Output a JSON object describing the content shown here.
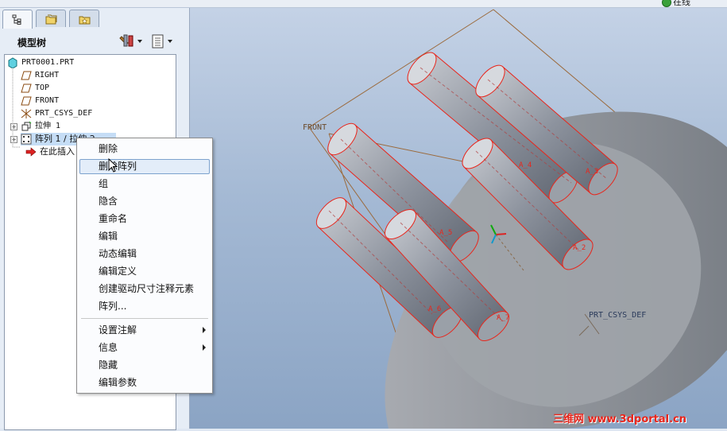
{
  "status": {
    "text": "在线"
  },
  "panel": {
    "tabs": [
      {
        "name": "model-tree",
        "icon": "tree-icon"
      },
      {
        "name": "folders",
        "icon": "folder-icon"
      },
      {
        "name": "favorites",
        "icon": "favorites-icon"
      }
    ],
    "title": "模型树",
    "settings_icon": "tools-icon",
    "show_icon": "list-icon"
  },
  "tree": {
    "items": [
      {
        "label": "PRT0001.PRT",
        "icon": "part-icon"
      },
      {
        "label": "RIGHT",
        "icon": "datum-plane-icon"
      },
      {
        "label": "TOP",
        "icon": "datum-plane-icon"
      },
      {
        "label": "FRONT",
        "icon": "datum-plane-icon"
      },
      {
        "label": "PRT_CSYS_DEF",
        "icon": "csys-icon"
      },
      {
        "label": "拉伸 1",
        "icon": "extrude-icon"
      },
      {
        "label": "阵列 1 / 拉伸 2",
        "icon": "pattern-icon"
      },
      {
        "label": "在此插入",
        "icon": "insert-arrow-icon"
      }
    ]
  },
  "context_menu": {
    "items": [
      {
        "label": "删除"
      },
      {
        "label": "删除阵列",
        "highlighted": true
      },
      {
        "label": "组"
      },
      {
        "label": "隐含"
      },
      {
        "label": "重命名"
      },
      {
        "label": "编辑"
      },
      {
        "label": "动态编辑"
      },
      {
        "label": "编辑定义"
      },
      {
        "label": "创建驱动尺寸注释元素"
      },
      {
        "label": "阵列..."
      },
      {
        "label": "设置注解",
        "submenu": true
      },
      {
        "label": "信息",
        "submenu": true
      },
      {
        "label": "隐藏"
      },
      {
        "label": "编辑参数"
      }
    ]
  },
  "viewport": {
    "datum_labels": {
      "front": "FRONT",
      "csys": "PRT_CSYS_DEF"
    },
    "axis_labels": [
      "A_3",
      "A_4",
      "A_5",
      "A_2",
      "A_6",
      "A_7"
    ],
    "colors": {
      "edge_highlight": "#e8261c",
      "datum": "#9b6a3c",
      "background_top": "#c4d2e6",
      "background_bottom": "#8ba4c4"
    }
  },
  "watermark": "三维网 www.3dportal.cn"
}
